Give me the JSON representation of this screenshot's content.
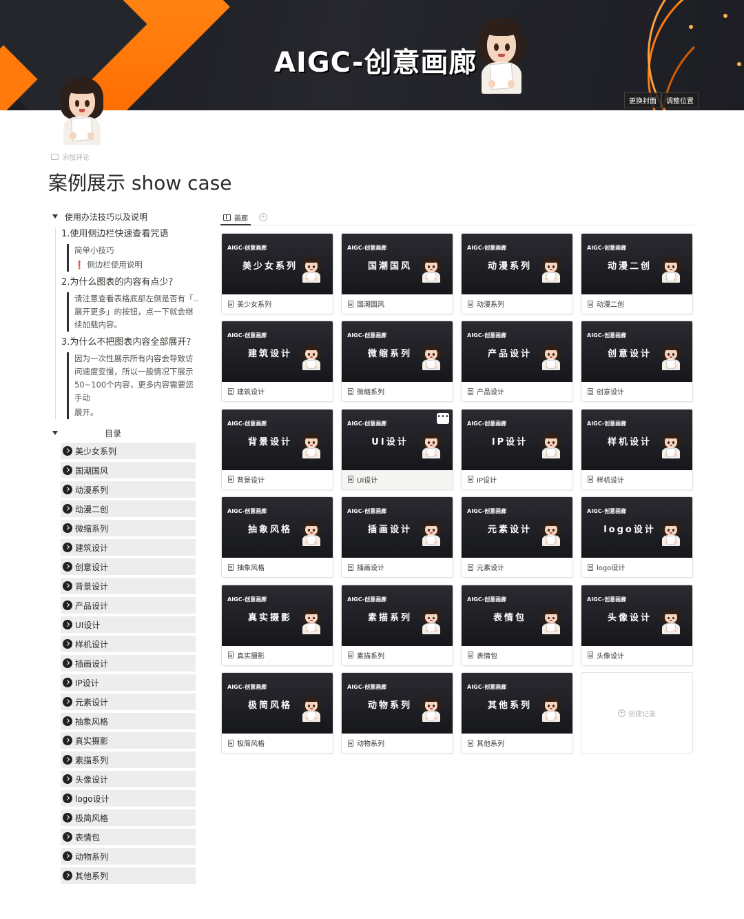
{
  "cover": {
    "title": "AIGC-创意画廊",
    "change_cover": "更换封面",
    "reposition": "调整位置"
  },
  "page": {
    "add_comment": "添加评论",
    "title": "案例展示 show case"
  },
  "sidebar": {
    "tips_toggle": "使用办法技巧以及说明",
    "q1": "1.使用侧边栏快速查看咒语",
    "q1_line1": "简单小技巧",
    "q1_line2": "侧边栏使用说明",
    "q1_warn": "❗",
    "q2": "2.为什么图表的内容有点少？",
    "q2_answer": "请注意查看表格底部左侧是否有「..展开更多」的按钮，点一下就会继续加载内容。",
    "q3": "3.为什么不把图表内容全部展开？",
    "q3_answer": "因为一次性展示所有内容会导致访问速度变慢，所以一般情况下展示50~100个内容，更多内容需要您手动",
    "q3_answer_end": "展开。",
    "toc_toggle": "目录",
    "toc": [
      "美少女系列",
      "国潮国风",
      "动漫系列",
      "动漫二创",
      "微缩系列",
      "建筑设计",
      "创意设计",
      "背景设计",
      "产品设计",
      "UI设计",
      "样机设计",
      "插画设计",
      "IP设计",
      "元素设计",
      "抽象风格",
      "真实摄影",
      "素描系列",
      "头像设计",
      "logo设计",
      "极简风格",
      "表情包",
      "动物系列",
      "其他系列"
    ]
  },
  "gallery": {
    "view_tab": "画廊",
    "add_view": "+",
    "brand": "AIGC-创意画廊",
    "new_record": "创建记录",
    "more": "•••",
    "cards": [
      {
        "title": "美少女系列",
        "name": "美少女系列"
      },
      {
        "title": "国潮国风",
        "name": "国潮国风"
      },
      {
        "title": "动漫系列",
        "name": "动漫系列"
      },
      {
        "title": "动漫二创",
        "name": "动漫二创"
      },
      {
        "title": "建筑设计",
        "name": "建筑设计"
      },
      {
        "title": "微缩系列",
        "name": "微缩系列"
      },
      {
        "title": "产品设计",
        "name": "产品设计"
      },
      {
        "title": "创意设计",
        "name": "创意设计"
      },
      {
        "title": "背景设计",
        "name": "背景设计"
      },
      {
        "title": "UI设计",
        "name": "UI设计"
      },
      {
        "title": "IP设计",
        "name": "IP设计"
      },
      {
        "title": "样机设计",
        "name": "样机设计"
      },
      {
        "title": "抽象风格",
        "name": "抽象风格"
      },
      {
        "title": "插画设计",
        "name": "插画设计"
      },
      {
        "title": "元素设计",
        "name": "元素设计"
      },
      {
        "title": "logo设计",
        "name": "logo设计"
      },
      {
        "title": "真实摄影",
        "name": "真实摄影"
      },
      {
        "title": "素描系列",
        "name": "素描系列"
      },
      {
        "title": "表情包",
        "name": "表情包"
      },
      {
        "title": "头像设计",
        "name": "头像设计"
      },
      {
        "title": "极简风格",
        "name": "极简风格"
      },
      {
        "title": "动物系列",
        "name": "动物系列"
      },
      {
        "title": "其他系列",
        "name": "其他系列"
      }
    ]
  },
  "colors": {
    "cover_bg": "#1d1e23",
    "cover_accent": "#ff7a0a",
    "toc_bg": "#ededed",
    "card_thumb_bg": "#1c1d22"
  }
}
